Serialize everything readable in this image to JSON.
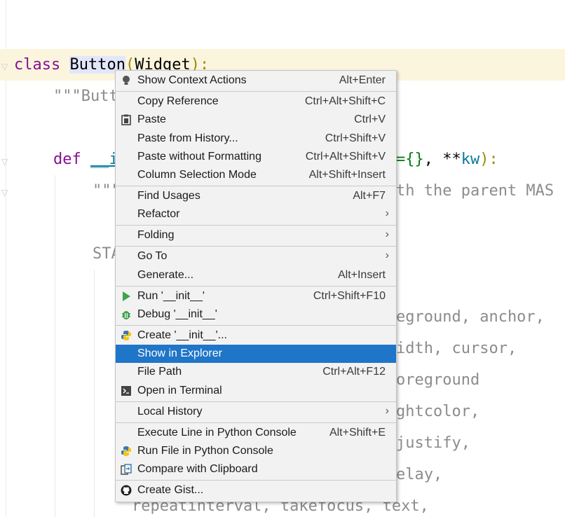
{
  "editor": {
    "lines": {
      "class_kw": "class",
      "class_name": "Button",
      "class_rest_open": "(",
      "class_base": "Widget",
      "class_rest_close": "):",
      "docstring_start": "\"\"\"Butt",
      "def_kw": "def",
      "def_name_start": "__i",
      "def_params_end_a": "={}",
      "def_params_end_b": ", **",
      "def_params_end_c": "kw",
      "def_params_end_d": "):",
      "doc2_start": "\"\"\"",
      "doc2_end": "th the parent MAS",
      "sta": "STA",
      "opt_1": "eground, anchor,",
      "opt_2": "idth, cursor,",
      "opt_3": "oreground",
      "opt_4": "ghtcolor,",
      "opt_5": "justify,",
      "opt_6": "elay,",
      "opt_7": "repeatinterval, takefocus, text,"
    }
  },
  "context_menu": {
    "items": [
      {
        "label": "Show Context Actions",
        "shortcut": "Alt+Enter",
        "icon": "bulb-icon"
      },
      {
        "label": "Copy Reference",
        "shortcut": "Ctrl+Alt+Shift+C",
        "icon": ""
      },
      {
        "label": "Paste",
        "shortcut": "Ctrl+V",
        "icon": "clipboard-icon"
      },
      {
        "label": "Paste from History...",
        "shortcut": "Ctrl+Shift+V",
        "icon": ""
      },
      {
        "label": "Paste without Formatting",
        "shortcut": "Ctrl+Alt+Shift+V",
        "icon": ""
      },
      {
        "label": "Column Selection Mode",
        "shortcut": "Alt+Shift+Insert",
        "icon": ""
      },
      {
        "label": "Find Usages",
        "shortcut": "Alt+F7",
        "icon": ""
      },
      {
        "label": "Refactor",
        "shortcut": "",
        "icon": "",
        "submenu": true
      },
      {
        "label": "Folding",
        "shortcut": "",
        "icon": "",
        "submenu": true
      },
      {
        "label": "Go To",
        "shortcut": "",
        "icon": "",
        "submenu": true
      },
      {
        "label": "Generate...",
        "shortcut": "Alt+Insert",
        "icon": ""
      },
      {
        "label": "Run '__init__'",
        "shortcut": "Ctrl+Shift+F10",
        "icon": "run-icon"
      },
      {
        "label": "Debug '__init__'",
        "shortcut": "",
        "icon": "debug-icon"
      },
      {
        "label": "Create '__init__'...",
        "shortcut": "",
        "icon": "python-icon"
      },
      {
        "label": "Show in Explorer",
        "shortcut": "",
        "icon": "",
        "selected": true
      },
      {
        "label": "File Path",
        "shortcut": "Ctrl+Alt+F12",
        "icon": ""
      },
      {
        "label": "Open in Terminal",
        "shortcut": "",
        "icon": "terminal-icon"
      },
      {
        "label": "Local History",
        "shortcut": "",
        "icon": "",
        "submenu": true
      },
      {
        "label": "Execute Line in Python Console",
        "shortcut": "Alt+Shift+E",
        "icon": ""
      },
      {
        "label": "Run File in Python Console",
        "shortcut": "",
        "icon": "python-icon"
      },
      {
        "label": "Compare with Clipboard",
        "shortcut": "",
        "icon": "compare-icon"
      },
      {
        "label": "Create Gist...",
        "shortcut": "",
        "icon": "github-icon"
      }
    ],
    "submenu_arrow": "›"
  },
  "colors": {
    "selection": "#1f75c8",
    "menu_bg": "#f2f2f2",
    "caret_row": "#fcf5dd"
  }
}
